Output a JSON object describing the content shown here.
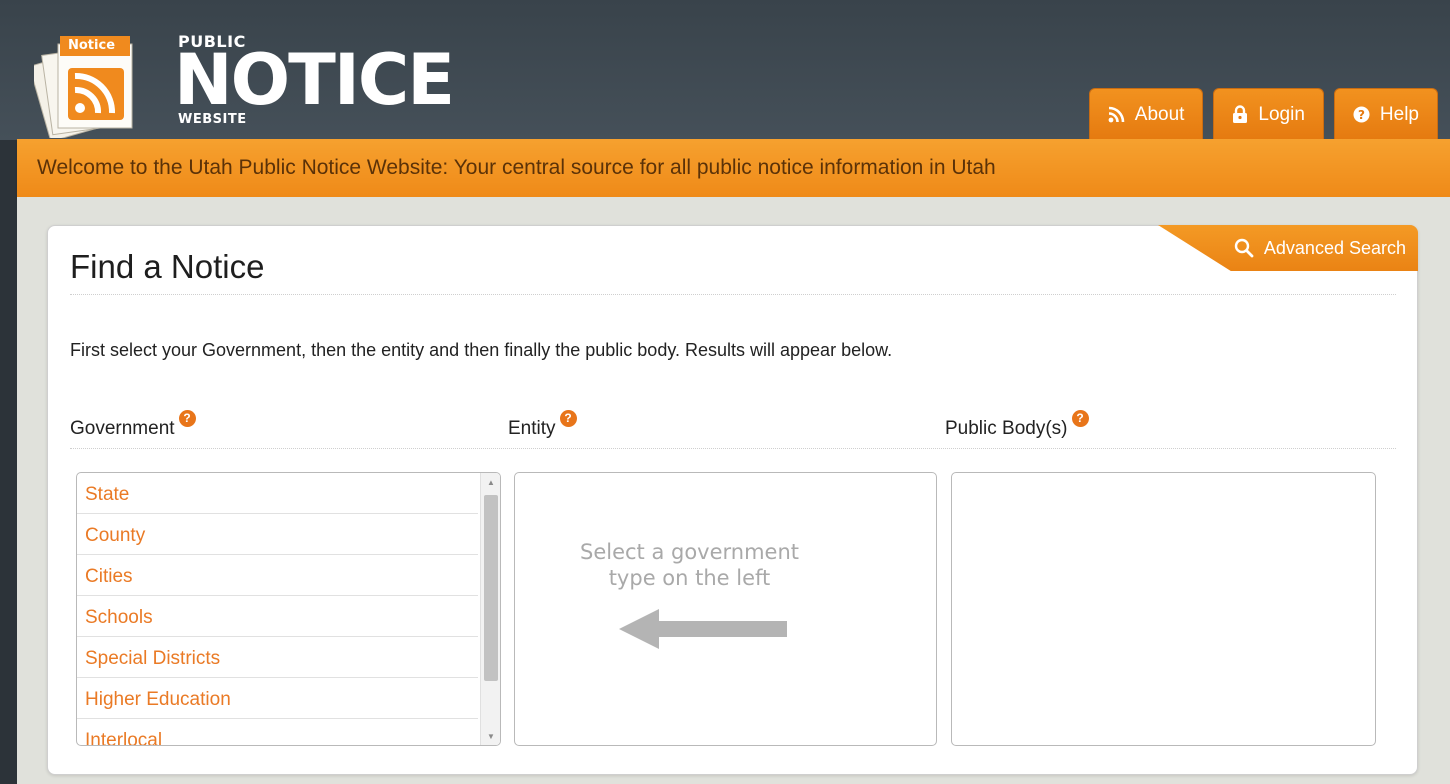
{
  "header": {
    "logo": {
      "badge_text": "Notice",
      "line_public": "PUBLIC",
      "line_notice": "NOTICE",
      "line_website": "WEBSITE"
    },
    "nav": [
      {
        "label": "About",
        "icon": "rss-icon"
      },
      {
        "label": "Login",
        "icon": "lock-icon"
      },
      {
        "label": "Help",
        "icon": "question-icon"
      }
    ]
  },
  "welcome_bar": {
    "text": "Welcome to the Utah Public Notice Website: Your central source for all public notice information in Utah"
  },
  "find_notice": {
    "title": "Find a Notice",
    "advanced_search_label": "Advanced Search",
    "instructions": "First select your Government, then the entity and then finally the public body. Results will appear below.",
    "columns": {
      "government": "Government",
      "entity": "Entity",
      "public_body": "Public Body(s)"
    },
    "help_glyph": "?",
    "government_options": [
      "State",
      "County",
      "Cities",
      "Schools",
      "Special Districts",
      "Higher Education",
      "Interlocal"
    ],
    "entity_hint": [
      "Select a government",
      "type on the left"
    ],
    "scroll_up_glyph": "▲",
    "scroll_down_glyph": "▼"
  },
  "colors": {
    "header_bg": "#3d474f",
    "accent_orange": "#ef8a18",
    "link_orange": "#ea7a25",
    "content_bg": "#e0e1db",
    "hint_gray": "#a9a9a9"
  }
}
